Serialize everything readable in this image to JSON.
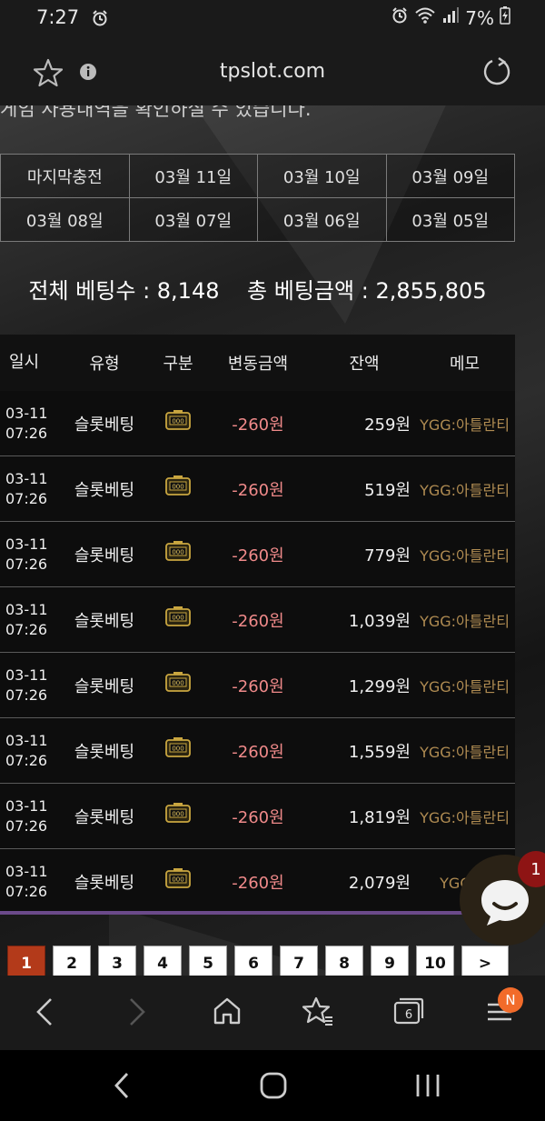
{
  "status_bar": {
    "time": "7:27",
    "battery": "7%"
  },
  "browser": {
    "url": "tpslot.com",
    "tab_count": "6",
    "notification_badge": "N"
  },
  "page": {
    "cut_text": "게임 사용내역을 확인하실 수 있습니다.",
    "date_tabs": [
      "마지막충전",
      "03월 11일",
      "03월 10일",
      "03월 09일",
      "03월 08일",
      "03월 07일",
      "03월 06일",
      "03월 05일"
    ],
    "summary": {
      "total_bets_label": "전체 베팅수",
      "total_bets": "8,148",
      "total_amount_label": "총 베팅금액",
      "total_amount": "2,855,805"
    },
    "table": {
      "headers": [
        "일시",
        "유형",
        "구분",
        "변동금액",
        "잔액",
        "메모"
      ],
      "rows": [
        {
          "date": "03-11",
          "time": "07:26",
          "type": "슬롯베팅",
          "amount": "-260원",
          "balance": "259원",
          "memo": "YGG:아틀란티"
        },
        {
          "date": "03-11",
          "time": "07:26",
          "type": "슬롯베팅",
          "amount": "-260원",
          "balance": "519원",
          "memo": "YGG:아틀란티"
        },
        {
          "date": "03-11",
          "time": "07:26",
          "type": "슬롯베팅",
          "amount": "-260원",
          "balance": "779원",
          "memo": "YGG:아틀란티"
        },
        {
          "date": "03-11",
          "time": "07:26",
          "type": "슬롯베팅",
          "amount": "-260원",
          "balance": "1,039원",
          "memo": "YGG:아틀란티"
        },
        {
          "date": "03-11",
          "time": "07:26",
          "type": "슬롯베팅",
          "amount": "-260원",
          "balance": "1,299원",
          "memo": "YGG:아틀란티"
        },
        {
          "date": "03-11",
          "time": "07:26",
          "type": "슬롯베팅",
          "amount": "-260원",
          "balance": "1,559원",
          "memo": "YGG:아틀란티"
        },
        {
          "date": "03-11",
          "time": "07:26",
          "type": "슬롯베팅",
          "amount": "-260원",
          "balance": "1,819원",
          "memo": "YGG:아틀란티"
        },
        {
          "date": "03-11",
          "time": "07:26",
          "type": "슬롯베팅",
          "amount": "-260원",
          "balance": "2,079원",
          "memo": "YGG:아"
        }
      ]
    },
    "pagination": {
      "pages": [
        "1",
        "2",
        "3",
        "4",
        "5",
        "6",
        "7",
        "8",
        "9",
        "10"
      ],
      "active": "1",
      "next": ">"
    },
    "chat_badge": "1"
  },
  "colors": {
    "accent_red": "#b33a1a",
    "amount_negative": "#f08a8a",
    "memo": "#b08c52",
    "divider_purple": "#6b4a8a"
  }
}
